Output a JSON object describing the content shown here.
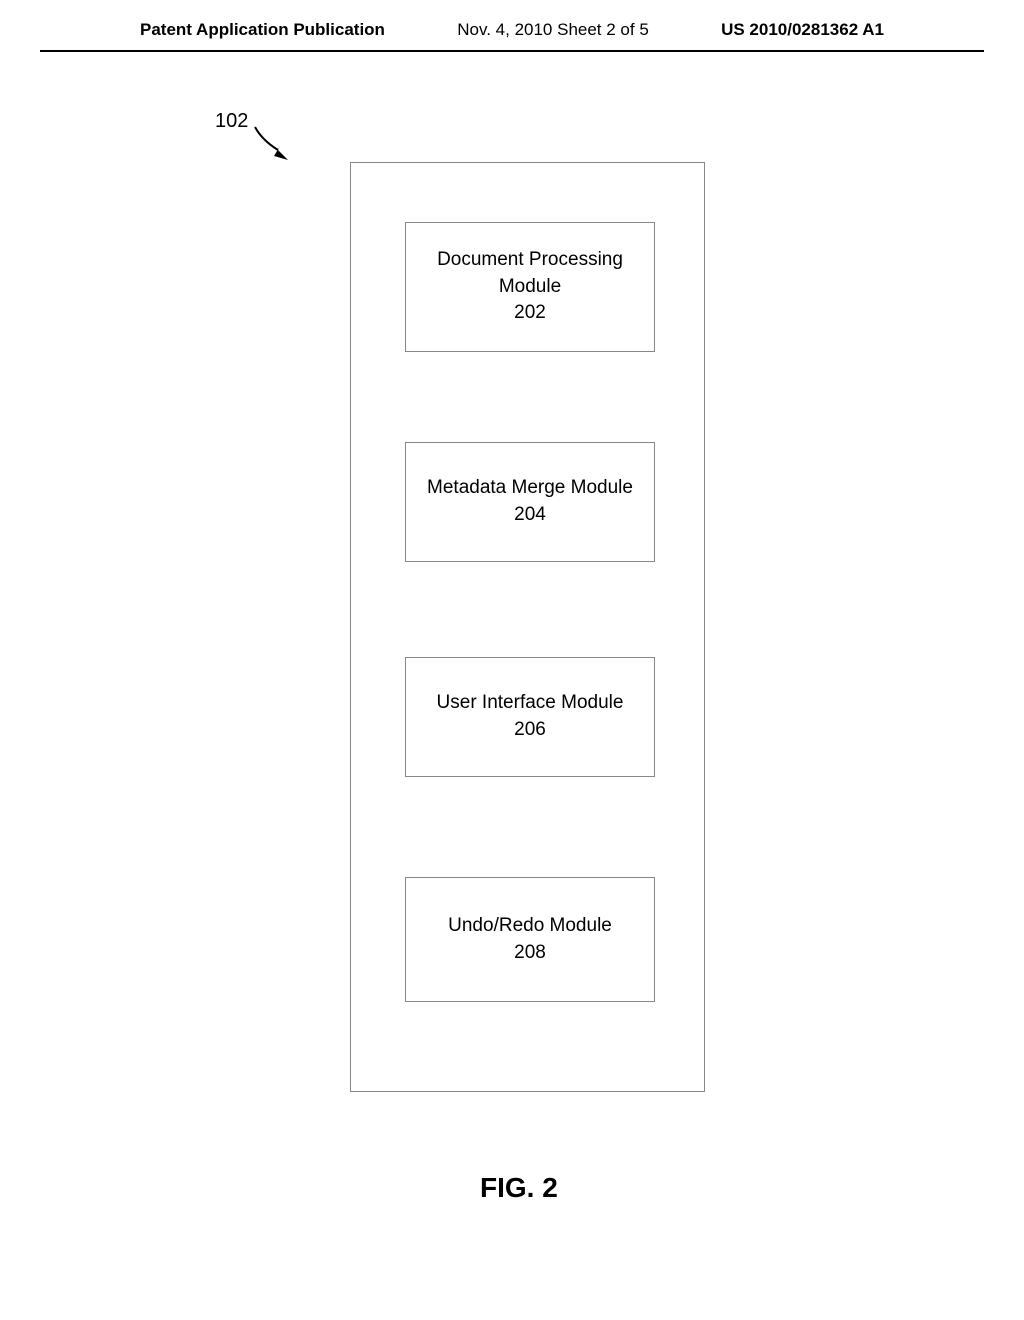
{
  "header": {
    "left": "Patent Application Publication",
    "center": "Nov. 4, 2010  Sheet 2 of 5",
    "right": "US 2010/0281362 A1"
  },
  "diagram": {
    "ref_number": "102",
    "modules": [
      {
        "title": "Document Processing Module",
        "num": "202"
      },
      {
        "title": "Metadata Merge Module",
        "num": "204"
      },
      {
        "title": "User Interface Module",
        "num": "206"
      },
      {
        "title": "Undo/Redo Module",
        "num": "208"
      }
    ],
    "figure_label": "FIG. 2"
  }
}
